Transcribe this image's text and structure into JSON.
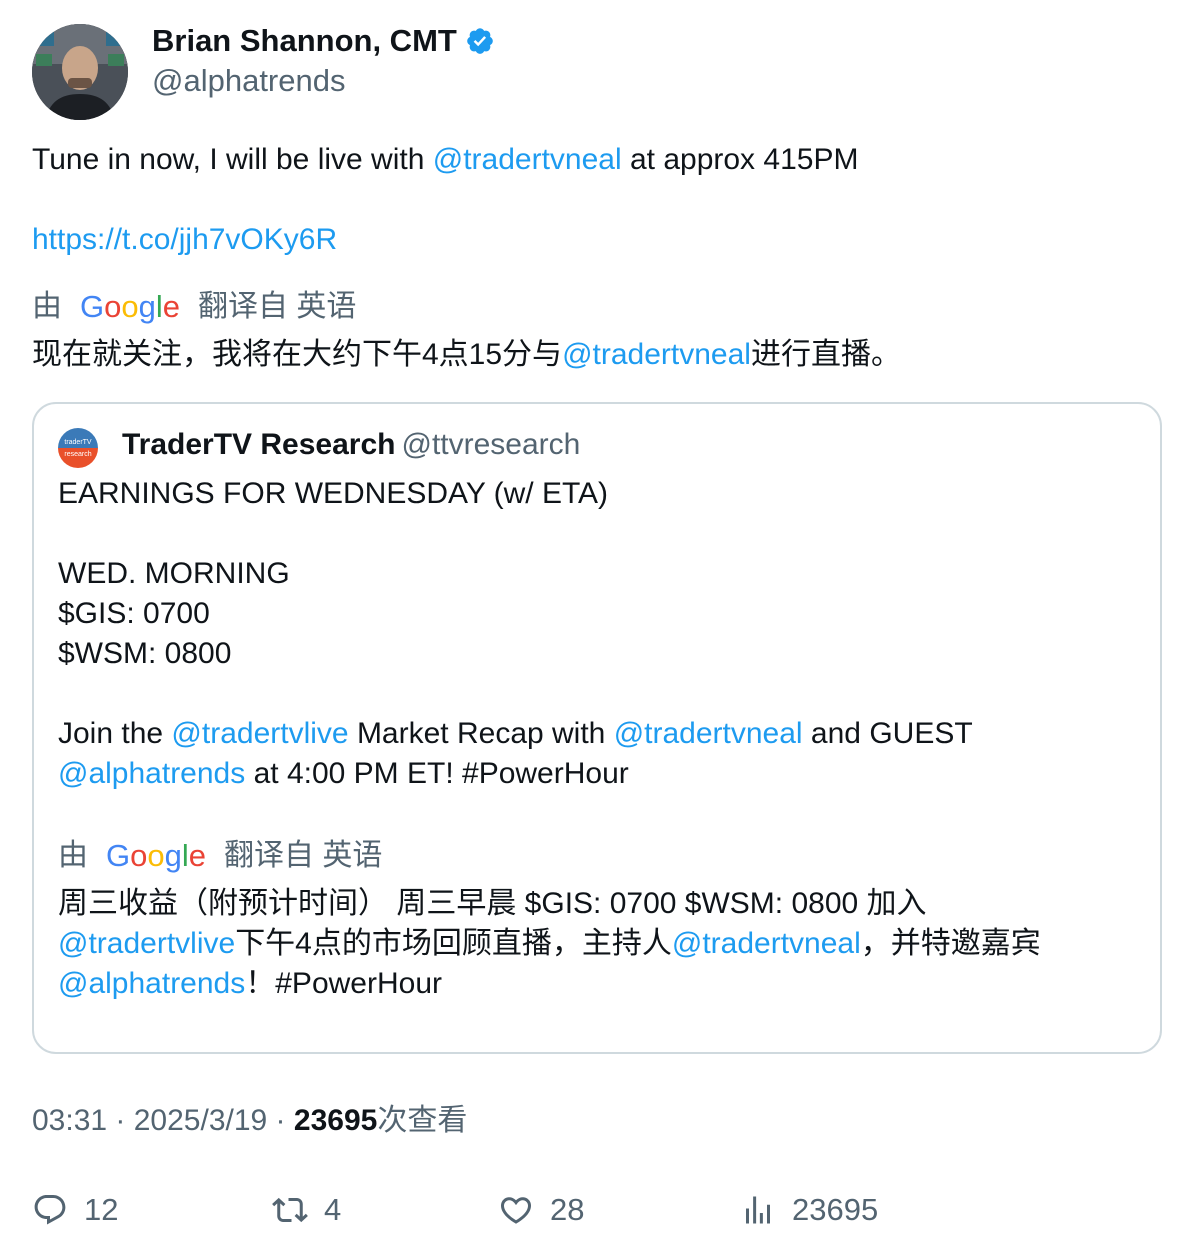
{
  "author": {
    "name": "Brian Shannon, CMT",
    "handle": "@alphatrends",
    "verified_color": "#1d9bf0"
  },
  "tweet": {
    "text_before": "Tune in now, I will be live with ",
    "mention": "@tradertvneal",
    "text_after": " at approx 415PM",
    "link": "https://t.co/jjh7vOKy6R"
  },
  "translation_label": {
    "by": "由",
    "logo": "Google",
    "translated_from": "翻译自 英语"
  },
  "translation": {
    "part1": "现在就关注，我将在大约下午4点15分与",
    "mention": "@tradertvneal",
    "part2": "进行直播。"
  },
  "quote": {
    "name": "TraderTV Research",
    "handle": "@ttvresearch",
    "avatar_text_top": "traderTV",
    "avatar_text_bottom": "research",
    "lines": {
      "l1": "EARNINGS FOR WEDNESDAY (w/ ETA)",
      "l2": "WED. MORNING",
      "l3": "$GIS: 0700",
      "l4": "$WSM: 0800",
      "l5_a": "Join the ",
      "l5_m1": "@tradertvlive",
      "l5_b": " Market Recap with ",
      "l5_m2": "@tradertvneal",
      "l5_c": " and GUEST",
      "l6_m": "@alphatrends",
      "l6_b": " at 4:00 PM ET! #PowerHour"
    },
    "translation_label": {
      "by": "由",
      "logo": "Google",
      "translated_from": "翻译自 英语"
    },
    "translation": {
      "t1": "周三收益（附预计时间） 周三早晨 $GIS: 0700 $WSM: 0800 加入",
      "t2_m": "@tradertvlive",
      "t2_b": "下午4点的市场回顾直播，主持人",
      "t2_m2": "@tradertvneal",
      "t2_c": "，并特邀嘉宾",
      "t3_m": "@alphatrends",
      "t3_b": "！#PowerHour"
    }
  },
  "meta": {
    "time": "03:31",
    "sep1": " · ",
    "date": "2025/3/19",
    "sep2": " · ",
    "views": "23695",
    "views_label": "次查看"
  },
  "actions": {
    "replies": "12",
    "retweets": "4",
    "likes": "28",
    "views": "23695"
  },
  "colors": {
    "link": "#1d9bf0",
    "muted": "#536471",
    "text": "#0f1419",
    "border": "#cfd9de"
  }
}
